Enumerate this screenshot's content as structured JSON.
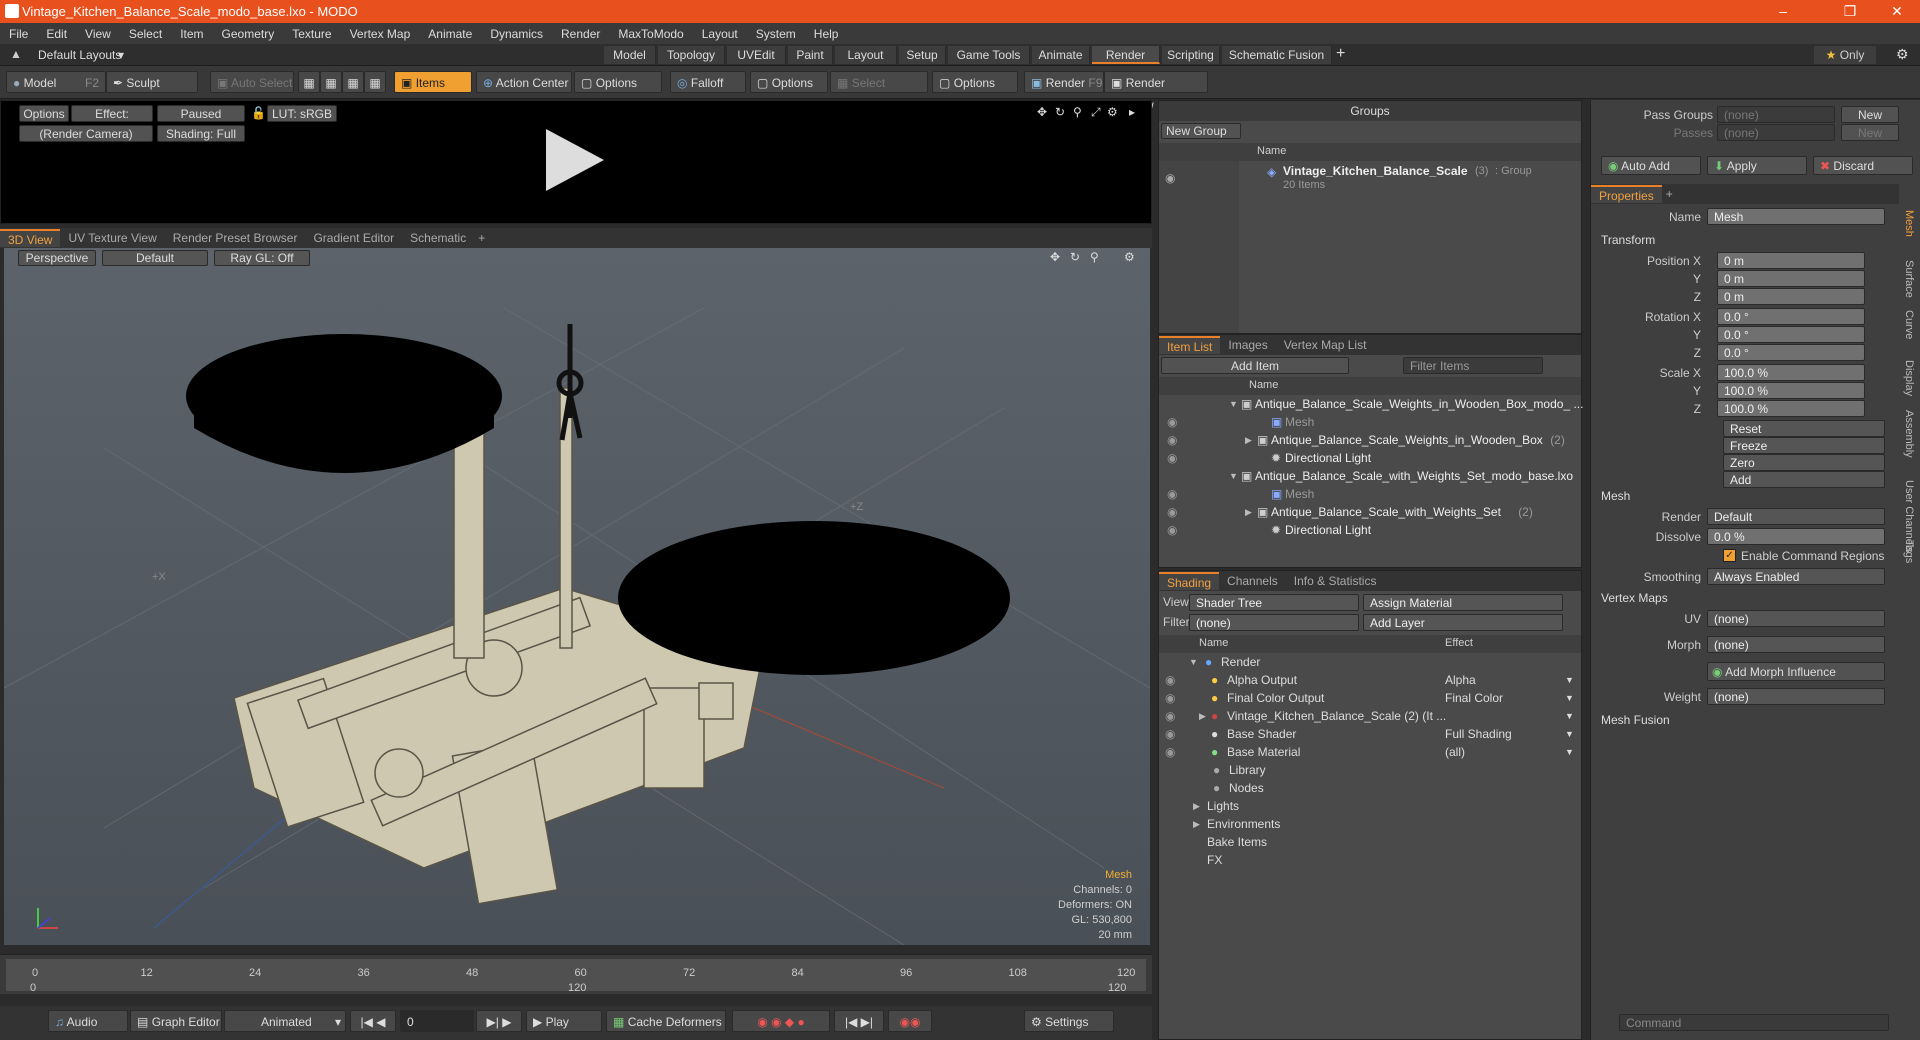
{
  "app": {
    "title": "Vintage_Kitchen_Balance_Scale_modo_base.lxo - MODO"
  },
  "menu": [
    "File",
    "Edit",
    "View",
    "Select",
    "Item",
    "Geometry",
    "Texture",
    "Vertex Map",
    "Animate",
    "Dynamics",
    "Render",
    "MaxToModo",
    "Layout",
    "System",
    "Help"
  ],
  "layouts": {
    "label": "Default Layouts",
    "tabs": [
      "Model",
      "Topology",
      "UVEdit",
      "Paint",
      "Layout",
      "Setup",
      "Game Tools",
      "Animate",
      "Render",
      "Scripting",
      "Schematic Fusion"
    ],
    "active": "Render",
    "only": "Only"
  },
  "toolbar": {
    "model": "Model",
    "model_key": "F2",
    "sculpt": "Sculpt",
    "auto_select": "Auto Select",
    "items": "Items",
    "action_center": "Action Center",
    "options": "Options",
    "falloff": "Falloff",
    "options2": "Options",
    "select_through": "Select Through",
    "options3": "Options",
    "render": "Render",
    "render_key": "F9",
    "render_window": "Render Window"
  },
  "render_preview": {
    "options": "Options",
    "effect": "Effect: (Shadi...",
    "paused": "Paused",
    "lut": "LUT: sRGB",
    "camera": "(Render Camera)",
    "shading": "Shading: Full"
  },
  "viewport_tabs": [
    "3D View",
    "UV Texture View",
    "Render Preset Browser",
    "Gradient Editor",
    "Schematic"
  ],
  "viewport": {
    "perspective": "Perspective",
    "default": "Default",
    "raygl": "Ray GL: Off",
    "axis_x": "+X",
    "axis_z": "+Z",
    "info_title": "Mesh",
    "info_lines": [
      "Channels: 0",
      "Deformers: ON",
      "GL: 530,800",
      "20 mm"
    ]
  },
  "timeline": {
    "ticks": [
      "0",
      "12",
      "24",
      "36",
      "48",
      "60",
      "72",
      "84",
      "96",
      "108",
      "120"
    ],
    "sub_ticks": [
      "0",
      "120",
      "120"
    ]
  },
  "bottom": {
    "audio": "Audio",
    "graph_editor": "Graph Editor",
    "animated": "Animated",
    "frame": "0",
    "play": "Play",
    "cache": "Cache Deformers",
    "settings": "Settings"
  },
  "groups": {
    "title": "Groups",
    "new_group": "New Group",
    "col_name": "Name",
    "item_name": "Vintage_Kitchen_Balance_Scale",
    "item_count": "(3)",
    "item_type": ": Group",
    "item_sub": "20 Items"
  },
  "itemlist": {
    "tabs": [
      "Item List",
      "Images",
      "Vertex Map List"
    ],
    "add_item": "Add Item",
    "filter": "Filter Items",
    "col_name": "Name",
    "rows": [
      {
        "t": "Antique_Balance_Scale_Weights_in_Wooden_Box_modo_ ...",
        "lvl": 0,
        "dim": false
      },
      {
        "t": "Mesh",
        "lvl": 2,
        "dim": true
      },
      {
        "t": "Antique_Balance_Scale_Weights_in_Wooden_Box",
        "c": "(2)",
        "lvl": 1,
        "dim": false
      },
      {
        "t": "Directional Light",
        "lvl": 2,
        "dim": false
      },
      {
        "t": "Antique_Balance_Scale_with_Weights_Set_modo_base.lxo",
        "lvl": 0,
        "dim": false
      },
      {
        "t": "Mesh",
        "lvl": 2,
        "dim": true
      },
      {
        "t": "Antique_Balance_Scale_with_Weights_Set",
        "c": "(2)",
        "lvl": 1,
        "dim": false
      },
      {
        "t": "Directional Light",
        "lvl": 2,
        "dim": false
      }
    ]
  },
  "shading": {
    "tabs": [
      "Shading",
      "Channels",
      "Info & Statistics"
    ],
    "view_label": "View",
    "view": "Shader Tree",
    "assign": "Assign Material",
    "filter_label": "Filter",
    "filter": "(none)",
    "add_layer": "Add Layer",
    "col_name": "Name",
    "col_effect": "Effect",
    "rows": [
      {
        "n": "Render",
        "e": ""
      },
      {
        "n": "Alpha Output",
        "e": "Alpha"
      },
      {
        "n": "Final Color Output",
        "e": "Final Color"
      },
      {
        "n": "Vintage_Kitchen_Balance_Scale (2) (It ...",
        "e": ""
      },
      {
        "n": "Base Shader",
        "e": "Full Shading"
      },
      {
        "n": "Base Material",
        "e": "(all)"
      },
      {
        "n": "Library",
        "e": ""
      },
      {
        "n": "Nodes",
        "e": ""
      },
      {
        "n": "Lights",
        "e": ""
      },
      {
        "n": "Environments",
        "e": ""
      },
      {
        "n": "Bake Items",
        "e": ""
      },
      {
        "n": "FX",
        "e": ""
      }
    ]
  },
  "props": {
    "pass_groups": "Pass Groups",
    "passes": "Passes",
    "none": "(none)",
    "new": "New",
    "auto_add": "Auto Add",
    "apply": "Apply",
    "discard": "Discard",
    "tab": "Properties",
    "name_label": "Name",
    "name": "Mesh",
    "transform": "Transform",
    "pos_label": "Position X",
    "pos": [
      "0 m",
      "0 m",
      "0 m"
    ],
    "rot_label": "Rotation X",
    "rot": [
      "0.0 °",
      "0.0 °",
      "0.0 °"
    ],
    "scale_label": "Scale X",
    "scale": [
      "100.0 %",
      "100.0 %",
      "100.0 %"
    ],
    "y": "Y",
    "z": "Z",
    "reset": "Reset",
    "freeze": "Freeze",
    "zero": "Zero",
    "add": "Add",
    "mesh": "Mesh",
    "render_label": "Render",
    "render": "Default",
    "dissolve_label": "Dissolve",
    "dissolve": "0.0 %",
    "enable_cmd": "Enable Command Regions",
    "smoothing_label": "Smoothing",
    "smoothing": "Always Enabled",
    "vertex_maps": "Vertex Maps",
    "uv_label": "UV",
    "uv": "(none)",
    "morph_label": "Morph",
    "morph": "(none)",
    "add_morph": "Add Morph Influence",
    "weight_label": "Weight",
    "weight": "(none)",
    "mesh_fusion": "Mesh Fusion",
    "side_tabs": [
      "Mesh",
      "Surface",
      "Curve",
      "Display",
      "Assembly",
      "User Channels",
      "Tags"
    ],
    "command": "Command"
  },
  "colors": {
    "accent": "#e8802a",
    "title_bar": "#e8501e",
    "viewport": "#586068"
  }
}
